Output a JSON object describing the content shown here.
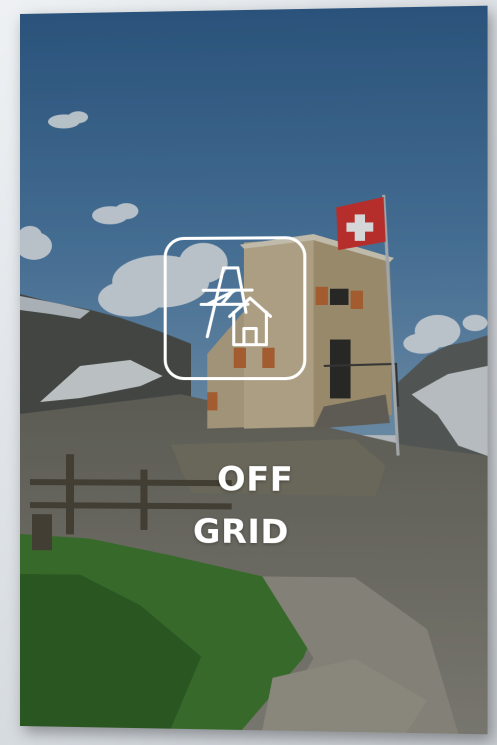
{
  "product": {
    "icon": "off-grid-power-pylon-house-icon",
    "title_line_1": "OFF",
    "title_line_2": "GRID"
  },
  "colors": {
    "sky": "#3e6e9b",
    "flag_red": "#d8322f",
    "hut_wall": "#cdbb98",
    "shutters": "#c26a34",
    "grass": "#3f7a2c",
    "icon_stroke": "#ffffff"
  }
}
